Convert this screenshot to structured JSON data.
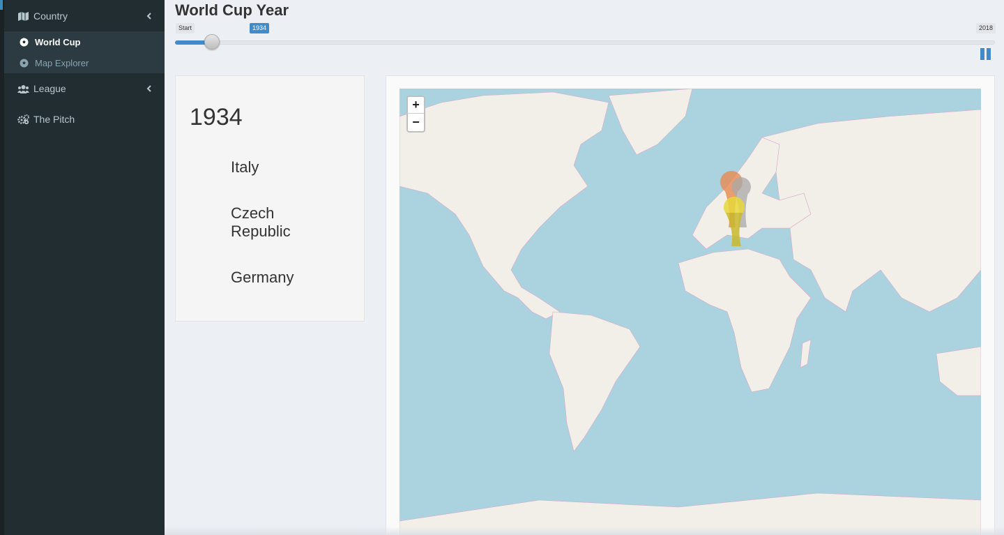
{
  "sidebar": {
    "items": [
      {
        "label": "Country",
        "icon": "map-icon"
      },
      {
        "label": "League",
        "icon": "users-icon"
      },
      {
        "label": "The Pitch",
        "icon": "gears-icon"
      }
    ],
    "subitems": [
      {
        "label": "World Cup",
        "icon": "soccer-ball-icon",
        "active": true
      },
      {
        "label": "Map Explorer",
        "icon": "soccer-ball-icon",
        "active": false
      }
    ]
  },
  "header": {
    "title": "World Cup Year"
  },
  "slider": {
    "start_label": "Start",
    "value_label": "1934",
    "end_label": "2018",
    "value": 1934,
    "min": 1930,
    "max": 2018,
    "fill_color": "#428bca"
  },
  "results": {
    "year": "1934",
    "first": "Italy",
    "second": "Czech Republic",
    "third": "Germany"
  },
  "map": {
    "zoom_in": "+",
    "zoom_out": "−",
    "water_color": "#aad3df",
    "land_color": "#f2efe9",
    "markers": [
      {
        "name": "gold-trophy-marker",
        "color": "#e8d83a"
      },
      {
        "name": "silver-trophy-marker",
        "color": "#a9a9a9"
      },
      {
        "name": "bronze-trophy-marker",
        "color": "#e98a52"
      }
    ]
  }
}
